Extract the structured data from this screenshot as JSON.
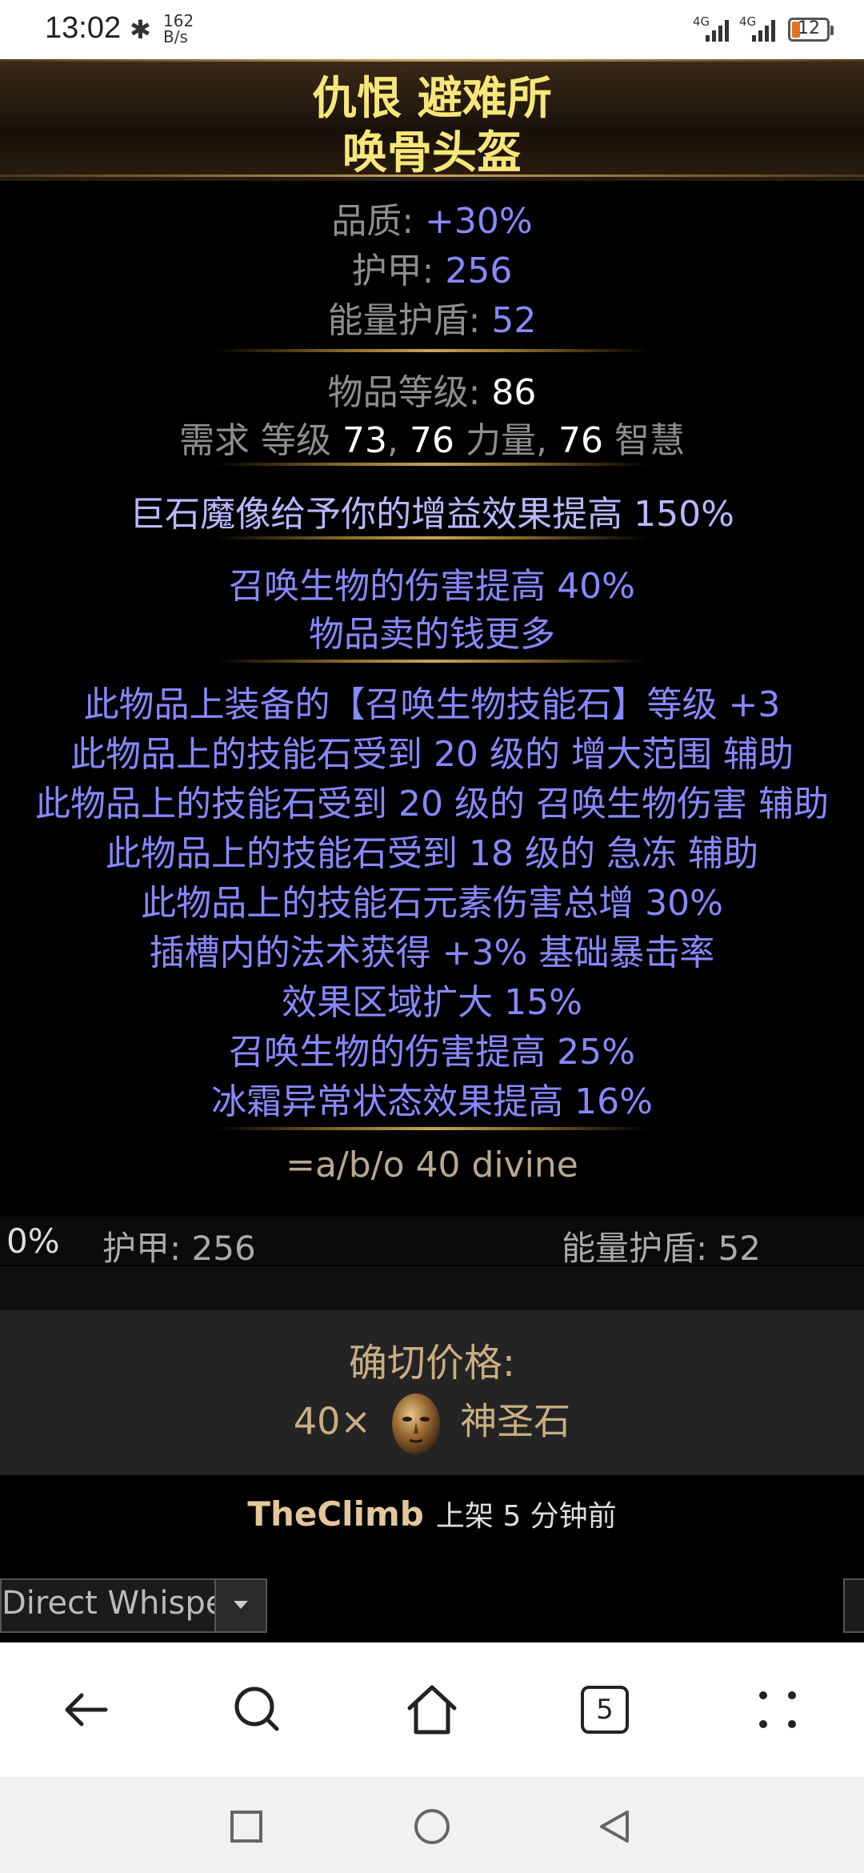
{
  "status_bar": {
    "time": "13:02",
    "net_speed_value": "162",
    "net_speed_unit": "B/s",
    "signal_label": "4G",
    "battery": "12"
  },
  "item": {
    "name_line1": "仇恨 避难所",
    "name_line2": "唤骨头盔",
    "props": {
      "quality_label": "品质: ",
      "quality_value": "+30%",
      "armour_label": "护甲: ",
      "armour_value": "256",
      "es_label": "能量护盾: ",
      "es_value": "52"
    },
    "level_label": "物品等级: ",
    "level_value": "86",
    "req": {
      "label": "需求 等级 ",
      "level": "73",
      "str": "76",
      "str_label": " 力量, ",
      "int": "76",
      "int_label": " 智慧"
    },
    "enchant": "巨石魔像给予你的增益效果提高 150%",
    "implicit_1": "召唤生物的伤害提高 40%",
    "implicit_2": "物品卖的钱更多",
    "explicit": [
      "此物品上装备的【召唤生物技能石】等级 +3",
      "此物品上的技能石受到 20 级的 增大范围 辅助",
      "此物品上的技能石受到 20 级的 召唤生物伤害 辅助",
      "此物品上的技能石受到 18 级的 急冻 辅助",
      "此物品上的技能石元素伤害总增 30%",
      "插槽内的法术获得 +3% 基础暴击率",
      "效果区域扩大 15%",
      "召唤生物的伤害提高 25%",
      "冰霜异常状态效果提高 16%"
    ],
    "note": "=a/b/o 40 divine"
  },
  "stats_bar": {
    "quality": "0%",
    "armour": "护甲: 256",
    "es": "能量护盾: 52"
  },
  "price": {
    "label": "确切价格:",
    "amount": "40×",
    "currency": "神圣石"
  },
  "seller": {
    "account": "TheClimb",
    "listed": "上架 5 分钟前"
  },
  "whisper": {
    "label": "Direct Whisper"
  },
  "browser_nav": {
    "tab_count": "5"
  },
  "colors": {
    "unique_name": "#f7e67a",
    "magic_mod": "#8888ff",
    "property_label": "#8e8e8e",
    "price_text": "#c9ae83"
  }
}
